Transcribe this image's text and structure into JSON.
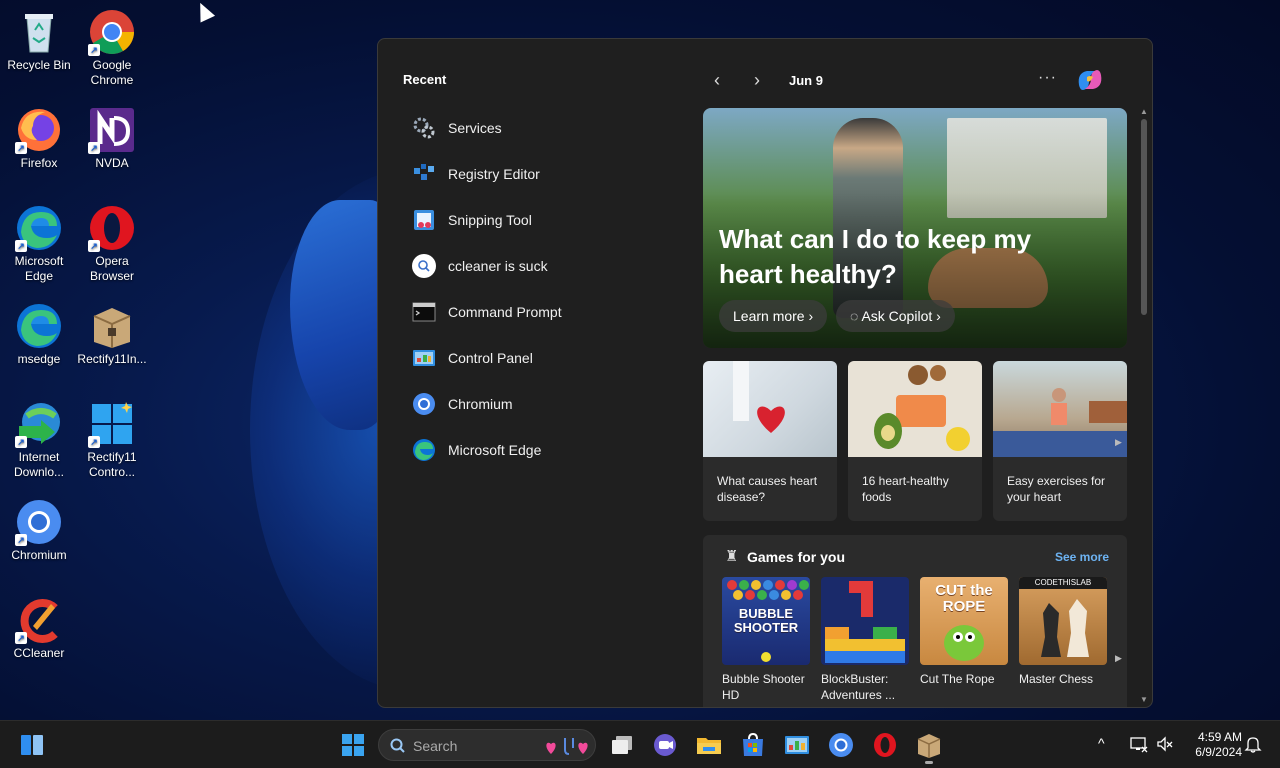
{
  "desktop": {
    "icons": [
      {
        "label": "Recycle Bin",
        "icon": "recycle-bin-icon"
      },
      {
        "label": "Google Chrome",
        "icon": "chrome-icon"
      },
      {
        "label": "Firefox",
        "icon": "firefox-icon"
      },
      {
        "label": "NVDA",
        "icon": "nvda-icon"
      },
      {
        "label": "Microsoft Edge",
        "icon": "edge-icon"
      },
      {
        "label": "Opera Browser",
        "icon": "opera-icon"
      },
      {
        "label": "msedge",
        "icon": "edge-icon"
      },
      {
        "label": "Rectify11In...",
        "icon": "package-icon"
      },
      {
        "label": "Internet Downlo...",
        "icon": "idm-icon"
      },
      {
        "label": "Rectify11 Contro...",
        "icon": "control-icon"
      },
      {
        "label": "Chromium",
        "icon": "chromium-icon"
      },
      {
        "label": "CCleaner",
        "icon": "ccleaner-icon"
      }
    ]
  },
  "widgets": {
    "recent_title": "Recent",
    "recent_items": [
      {
        "label": "Services",
        "icon": "services-gear-icon"
      },
      {
        "label": "Registry Editor",
        "icon": "registry-editor-icon"
      },
      {
        "label": "Snipping Tool",
        "icon": "snipping-tool-icon"
      },
      {
        "label": "ccleaner is suck",
        "icon": "search-icon"
      },
      {
        "label": "Command Prompt",
        "icon": "command-prompt-icon"
      },
      {
        "label": "Control Panel",
        "icon": "control-panel-icon"
      },
      {
        "label": "Chromium",
        "icon": "chromium-icon"
      },
      {
        "label": "Microsoft Edge",
        "icon": "edge-icon"
      }
    ],
    "nav": {
      "prev": "‹",
      "next": "›",
      "date": "Jun 9",
      "more": "···"
    },
    "hero": {
      "title": "What can I do to keep my heart healthy?",
      "learn_more": "Learn more",
      "ask_copilot": "Ask Copilot"
    },
    "cards": [
      {
        "caption": "What causes heart disease?"
      },
      {
        "caption": "16 heart-healthy foods"
      },
      {
        "caption": "Easy exercises for your heart"
      }
    ],
    "games": {
      "title": "Games for you",
      "see_more": "See more",
      "items": [
        {
          "name": "Bubble Shooter HD",
          "art": "BUBBLE SHOOTER"
        },
        {
          "name": "BlockBuster: Adventures ...",
          "art": ""
        },
        {
          "name": "Cut The Rope",
          "art": "CUT the ROPE"
        },
        {
          "name": "Master Chess",
          "art": "CODETHISLAB"
        }
      ]
    }
  },
  "taskbar": {
    "search_placeholder": "Search",
    "time": "4:59 AM",
    "date": "6/9/2024",
    "tray_chevron": "^"
  },
  "colors": {
    "accent": "#6db3f2",
    "panel_bg": "#1f1f1f",
    "card_bg": "#2b2b2b",
    "taskbar_bg": "#1c1c1c"
  }
}
